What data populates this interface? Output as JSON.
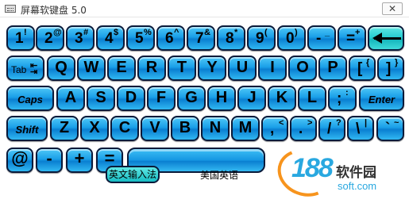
{
  "window": {
    "title": "屏幕软键盘 5.0",
    "close_label": "✕"
  },
  "rows": {
    "number": [
      {
        "main": "1",
        "shift": "!"
      },
      {
        "main": "2",
        "shift": "@"
      },
      {
        "main": "3",
        "shift": "#"
      },
      {
        "main": "4",
        "shift": "$"
      },
      {
        "main": "5",
        "shift": "%"
      },
      {
        "main": "6",
        "shift": "^"
      },
      {
        "main": "7",
        "shift": "&"
      },
      {
        "main": "8",
        "shift": "*"
      },
      {
        "main": "9",
        "shift": "("
      },
      {
        "main": "0",
        "shift": ")"
      },
      {
        "main": "-",
        "shift": "_"
      },
      {
        "main": "=",
        "shift": "+"
      }
    ],
    "top": [
      {
        "main": "Tab"
      },
      {
        "main": "Q"
      },
      {
        "main": "W"
      },
      {
        "main": "E"
      },
      {
        "main": "R"
      },
      {
        "main": "T"
      },
      {
        "main": "Y"
      },
      {
        "main": "U"
      },
      {
        "main": "I"
      },
      {
        "main": "O"
      },
      {
        "main": "P"
      },
      {
        "main": "[",
        "shift": "{"
      },
      {
        "main": "]",
        "shift": "}"
      }
    ],
    "home": [
      {
        "main": "Caps"
      },
      {
        "main": "A"
      },
      {
        "main": "S"
      },
      {
        "main": "D"
      },
      {
        "main": "F"
      },
      {
        "main": "G"
      },
      {
        "main": "H"
      },
      {
        "main": "J"
      },
      {
        "main": "K"
      },
      {
        "main": "L"
      },
      {
        "main": ";",
        "shift": ":"
      },
      {
        "main": "Enter"
      }
    ],
    "bottom": [
      {
        "main": "Shift"
      },
      {
        "main": "Z"
      },
      {
        "main": "X"
      },
      {
        "main": "C"
      },
      {
        "main": "V"
      },
      {
        "main": "B"
      },
      {
        "main": "N"
      },
      {
        "main": "M"
      },
      {
        "main": ",",
        "shift": "<"
      },
      {
        "main": ".",
        "shift": ">"
      },
      {
        "main": "/",
        "shift": "?"
      },
      {
        "main": "\\",
        "shift": "|"
      },
      {
        "main": "`",
        "shift": "~"
      }
    ],
    "calc": [
      {
        "main": "@"
      },
      {
        "main": "-"
      },
      {
        "main": "+"
      },
      {
        "main": "="
      }
    ]
  },
  "footer": {
    "ime_button": "英文输入法",
    "layout_label": "美国英语"
  },
  "watermark": {
    "number": "188",
    "name": "软件园",
    "url": "soft.com"
  },
  "colors": {
    "key_blue": "#1a9fe8",
    "key_teal": "#23cbd0",
    "key_border": "#0a1a3a"
  }
}
